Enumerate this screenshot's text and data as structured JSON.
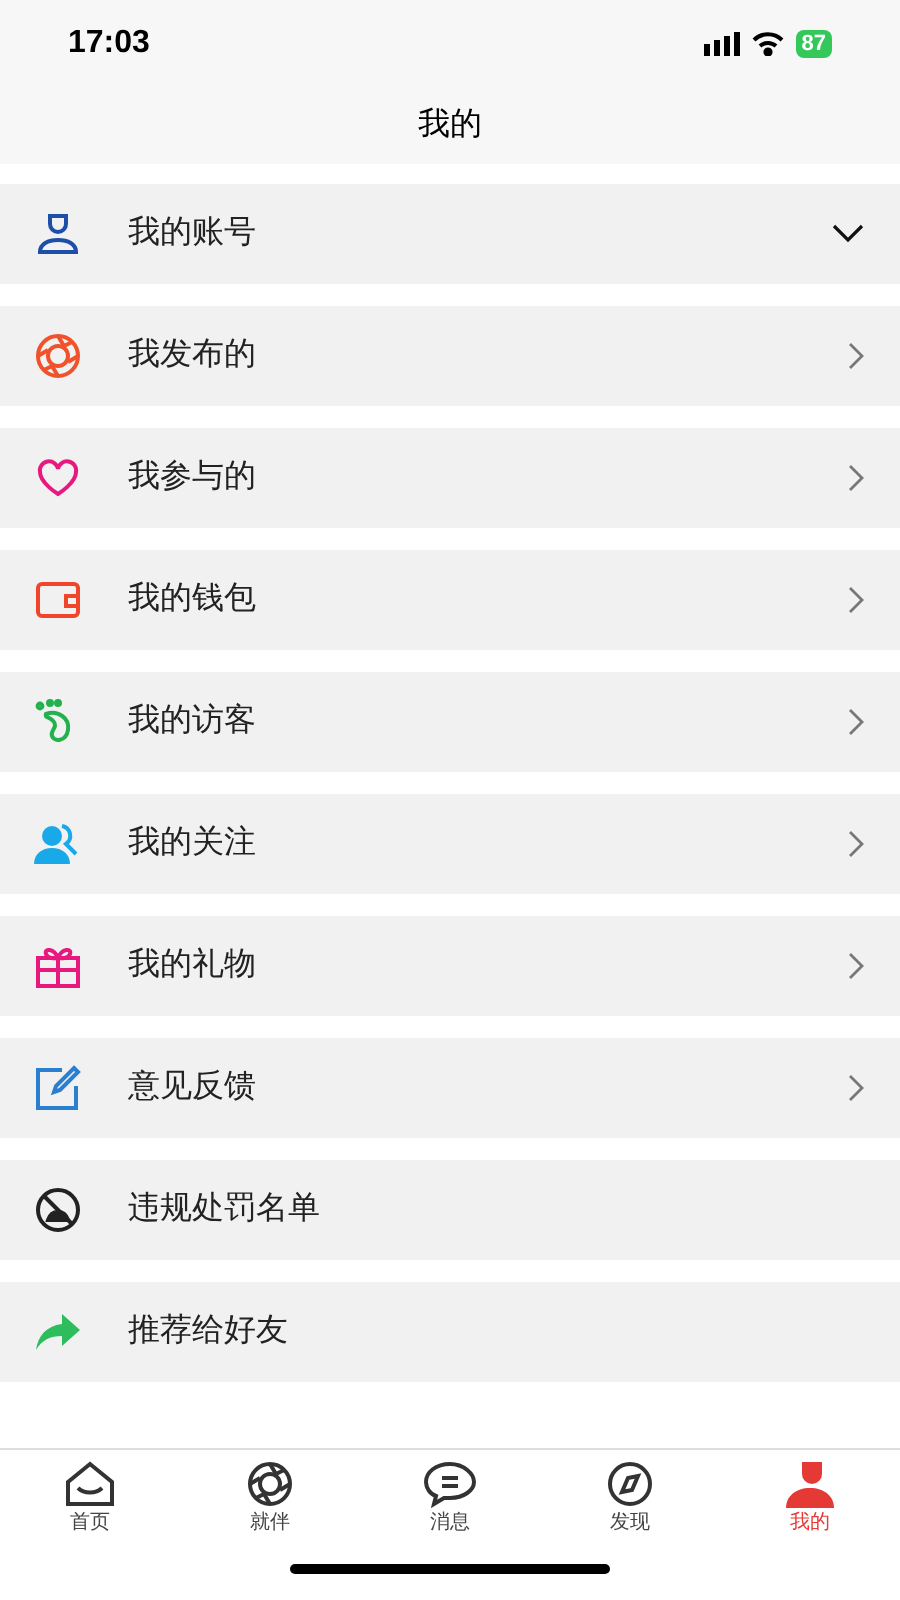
{
  "status_bar": {
    "time": "17:03",
    "battery": "87"
  },
  "header": {
    "title": "我的"
  },
  "menu": [
    {
      "label": "我的账号",
      "kind": "expand"
    },
    {
      "label": "我发布的",
      "kind": "link"
    },
    {
      "label": "我参与的",
      "kind": "link"
    },
    {
      "label": "我的钱包",
      "kind": "link"
    },
    {
      "label": "我的访客",
      "kind": "link"
    },
    {
      "label": "我的关注",
      "kind": "link"
    },
    {
      "label": "我的礼物",
      "kind": "link"
    },
    {
      "label": "意见反馈",
      "kind": "link"
    },
    {
      "label": "违规处罚名单",
      "kind": "plain"
    },
    {
      "label": "推荐给好友",
      "kind": "plain"
    }
  ],
  "tab_bar": [
    {
      "label": "首页",
      "selected": false
    },
    {
      "label": "就伴",
      "selected": false
    },
    {
      "label": "消息",
      "selected": false
    },
    {
      "label": "发现",
      "selected": false
    },
    {
      "label": "我的",
      "selected": true
    }
  ]
}
